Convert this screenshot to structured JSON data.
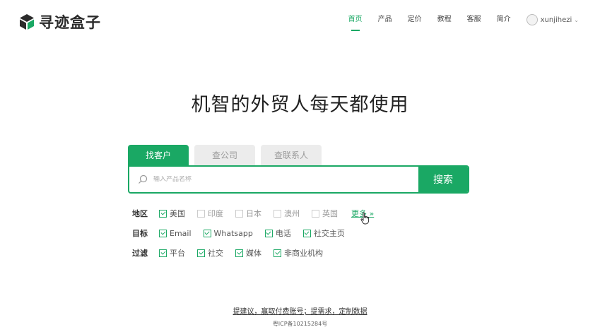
{
  "brand": {
    "name": "寻迹盒子"
  },
  "nav": {
    "items": [
      {
        "label": "首页",
        "active": true
      },
      {
        "label": "产品",
        "active": false
      },
      {
        "label": "定价",
        "active": false
      },
      {
        "label": "教程",
        "active": false
      },
      {
        "label": "客服",
        "active": false
      },
      {
        "label": "简介",
        "active": false
      }
    ],
    "username": "xunjihezi",
    "caret": "⌄"
  },
  "headline": "机智的外贸人每天都使用",
  "tabs": [
    {
      "label": "找客户",
      "active": true
    },
    {
      "label": "查公司",
      "active": false
    },
    {
      "label": "查联系人",
      "active": false
    }
  ],
  "search": {
    "placeholder": "输入产品名称",
    "value": "",
    "button_label": "搜索"
  },
  "filters": {
    "region": {
      "label": "地区",
      "options": [
        {
          "label": "美国",
          "checked": true
        },
        {
          "label": "印度",
          "checked": false
        },
        {
          "label": "日本",
          "checked": false
        },
        {
          "label": "澳州",
          "checked": false
        },
        {
          "label": "英国",
          "checked": false
        }
      ],
      "more_label": "更多 »"
    },
    "target": {
      "label": "目标",
      "options": [
        {
          "label": "Email",
          "checked": true
        },
        {
          "label": "Whatsapp",
          "checked": true
        },
        {
          "label": "电话",
          "checked": true
        },
        {
          "label": "社交主页",
          "checked": true
        }
      ]
    },
    "filter": {
      "label": "过滤",
      "options": [
        {
          "label": "平台",
          "checked": true
        },
        {
          "label": "社交",
          "checked": true
        },
        {
          "label": "媒体",
          "checked": true
        },
        {
          "label": "非商业机构",
          "checked": true
        }
      ]
    }
  },
  "footer": {
    "link_text": "提建议，赢取付费账号；提需求，定制数据",
    "icp": "粤ICP备10215284号"
  },
  "colors": {
    "accent": "#1aa864",
    "text": "#333333",
    "muted": "#999999",
    "tab_inactive_bg": "#ececec"
  }
}
